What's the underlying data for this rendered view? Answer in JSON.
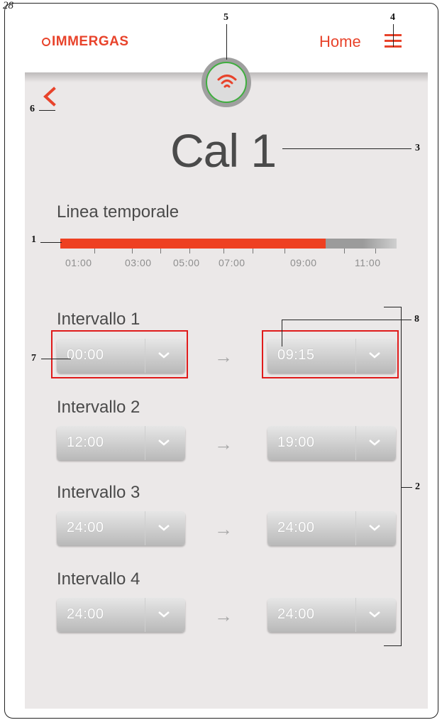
{
  "page_number": "28",
  "callouts": {
    "timeline": "1",
    "intervals": "2",
    "title": "3",
    "menu": "4",
    "connection": "5",
    "back": "6",
    "start_time": "7",
    "end_time": "8"
  },
  "header": {
    "logo": "IMMERGAS",
    "home_label": "Home",
    "menu_icon": "hamburger-menu-icon",
    "connection_icon": "wifi-icon",
    "accent_color": "#e8432b",
    "connection_ring_color": "#3fae3f"
  },
  "screen": {
    "back_icon": "chevron-left-icon",
    "title": "Cal 1",
    "timeline": {
      "heading": "Linea temporale",
      "fill_fraction": 0.79,
      "fill_color": "#ee4021",
      "tick_labels": [
        "01:00",
        "03:00",
        "05:00",
        "07:00",
        "09:00",
        "11:00"
      ]
    },
    "arrow_icon": "arrow-right-icon",
    "intervals": [
      {
        "label": "Intervallo 1",
        "start": "00:00",
        "end": "09:15"
      },
      {
        "label": "Intervallo 2",
        "start": "12:00",
        "end": "19:00"
      },
      {
        "label": "Intervallo 3",
        "start": "24:00",
        "end": "24:00"
      },
      {
        "label": "Intervallo 4",
        "start": "24:00",
        "end": "24:00"
      }
    ]
  }
}
